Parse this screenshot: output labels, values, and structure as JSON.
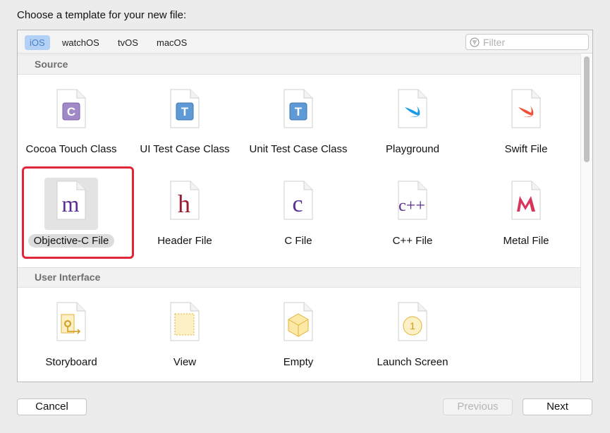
{
  "heading": "Choose a template for your new file:",
  "tabs": [
    {
      "label": "iOS",
      "active": true
    },
    {
      "label": "watchOS",
      "active": false
    },
    {
      "label": "tvOS",
      "active": false
    },
    {
      "label": "macOS",
      "active": false
    }
  ],
  "filter": {
    "placeholder": "Filter",
    "value": ""
  },
  "sections": [
    {
      "title": "Source",
      "items": [
        {
          "label": "Cocoa Touch Class",
          "icon": "cocoa-touch-class-icon",
          "glyph": "C"
        },
        {
          "label": "UI Test Case Class",
          "icon": "ui-test-case-class-icon",
          "glyph": "T"
        },
        {
          "label": "Unit Test Case Class",
          "icon": "unit-test-case-class-icon",
          "glyph": "T"
        },
        {
          "label": "Playground",
          "icon": "playground-icon",
          "glyph": ""
        },
        {
          "label": "Swift File",
          "icon": "swift-file-icon",
          "glyph": ""
        },
        {
          "label": "Objective-C File",
          "icon": "objective-c-file-icon",
          "glyph": "m",
          "selected": true
        },
        {
          "label": "Header File",
          "icon": "header-file-icon",
          "glyph": "h"
        },
        {
          "label": "C File",
          "icon": "c-file-icon",
          "glyph": "c"
        },
        {
          "label": "C++ File",
          "icon": "cpp-file-icon",
          "glyph": "c++"
        },
        {
          "label": "Metal File",
          "icon": "metal-file-icon",
          "glyph": ""
        }
      ]
    },
    {
      "title": "User Interface",
      "items": [
        {
          "label": "Storyboard",
          "icon": "storyboard-icon",
          "glyph": ""
        },
        {
          "label": "View",
          "icon": "view-icon",
          "glyph": ""
        },
        {
          "label": "Empty",
          "icon": "empty-icon",
          "glyph": ""
        },
        {
          "label": "Launch Screen",
          "icon": "launch-screen-icon",
          "glyph": "1"
        }
      ]
    }
  ],
  "buttons": {
    "cancel": "Cancel",
    "previous": "Previous",
    "next": "Next"
  },
  "colors": {
    "accent": "#b3d1f5",
    "selection_outline": "#e1263a",
    "objc_purple": "#5a2d91",
    "header_red": "#9b1b30"
  }
}
